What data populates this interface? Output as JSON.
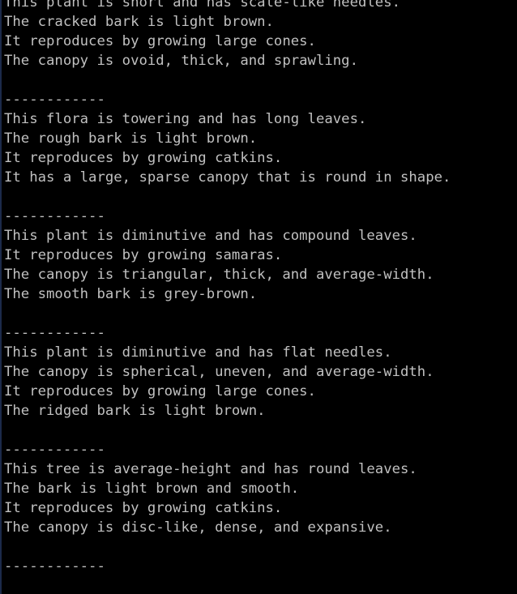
{
  "colors": {
    "background": "#000000",
    "text": "#c0c0c0"
  },
  "blocks": [
    {
      "lines": [
        "This plant is short and has scale-like needles.",
        "The cracked bark is light brown.",
        "It reproduces by growing large cones.",
        "The canopy is ovoid, thick, and sprawling."
      ],
      "separator": "------------"
    },
    {
      "lines": [
        "This flora is towering and has long leaves.",
        "The rough bark is light brown.",
        "It reproduces by growing catkins.",
        "It has a large, sparse canopy that is round in shape."
      ],
      "separator": "------------"
    },
    {
      "lines": [
        "This plant is diminutive and has compound leaves.",
        "It reproduces by growing samaras.",
        "The canopy is triangular, thick, and average-width.",
        "The smooth bark is grey-brown."
      ],
      "separator": "------------"
    },
    {
      "lines": [
        "This plant is diminutive and has flat needles.",
        "The canopy is spherical, uneven, and average-width.",
        "It reproduces by growing large cones.",
        "The ridged bark is light brown."
      ],
      "separator": "------------"
    },
    {
      "lines": [
        "This tree is average-height and has round leaves.",
        "The bark is light brown and smooth.",
        "It reproduces by growing catkins.",
        "The canopy is disc-like, dense, and expansive."
      ],
      "separator": "------------"
    }
  ]
}
